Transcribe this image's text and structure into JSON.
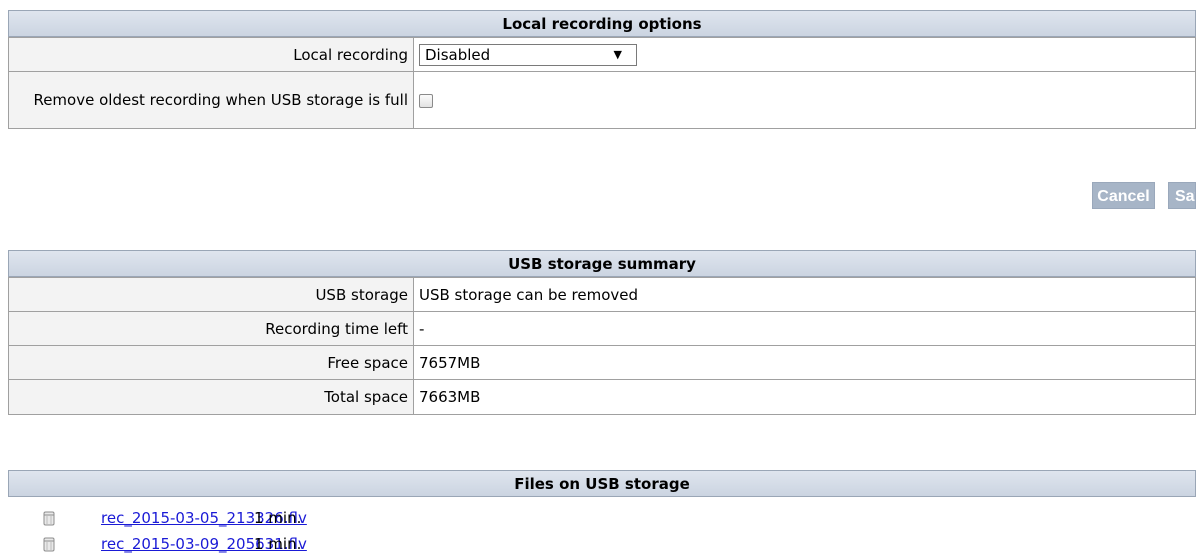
{
  "recording": {
    "header": "Local recording options",
    "local_recording_label": "Local recording",
    "local_recording_value": "Disabled",
    "remove_oldest_label": "Remove oldest recording when USB storage is full",
    "remove_oldest_checked": false
  },
  "buttons": {
    "cancel": "Cancel",
    "save": "Save"
  },
  "usb_summary": {
    "header": "USB storage summary",
    "rows": [
      {
        "label": "USB storage",
        "value": "USB storage can be removed"
      },
      {
        "label": "Recording time left",
        "value": "-"
      },
      {
        "label": "Free space",
        "value": "7657MB"
      },
      {
        "label": "Total space",
        "value": "7663MB"
      }
    ]
  },
  "files": {
    "header": "Files on USB storage",
    "items": [
      {
        "name": "rec_2015-03-05_213326.flv",
        "duration": "1 min."
      },
      {
        "name": "rec_2015-03-09_205631.flv",
        "duration": "1 min."
      }
    ]
  },
  "icons": {
    "file": "usb-file-icon",
    "dropdown": "chevron-down-icon"
  }
}
